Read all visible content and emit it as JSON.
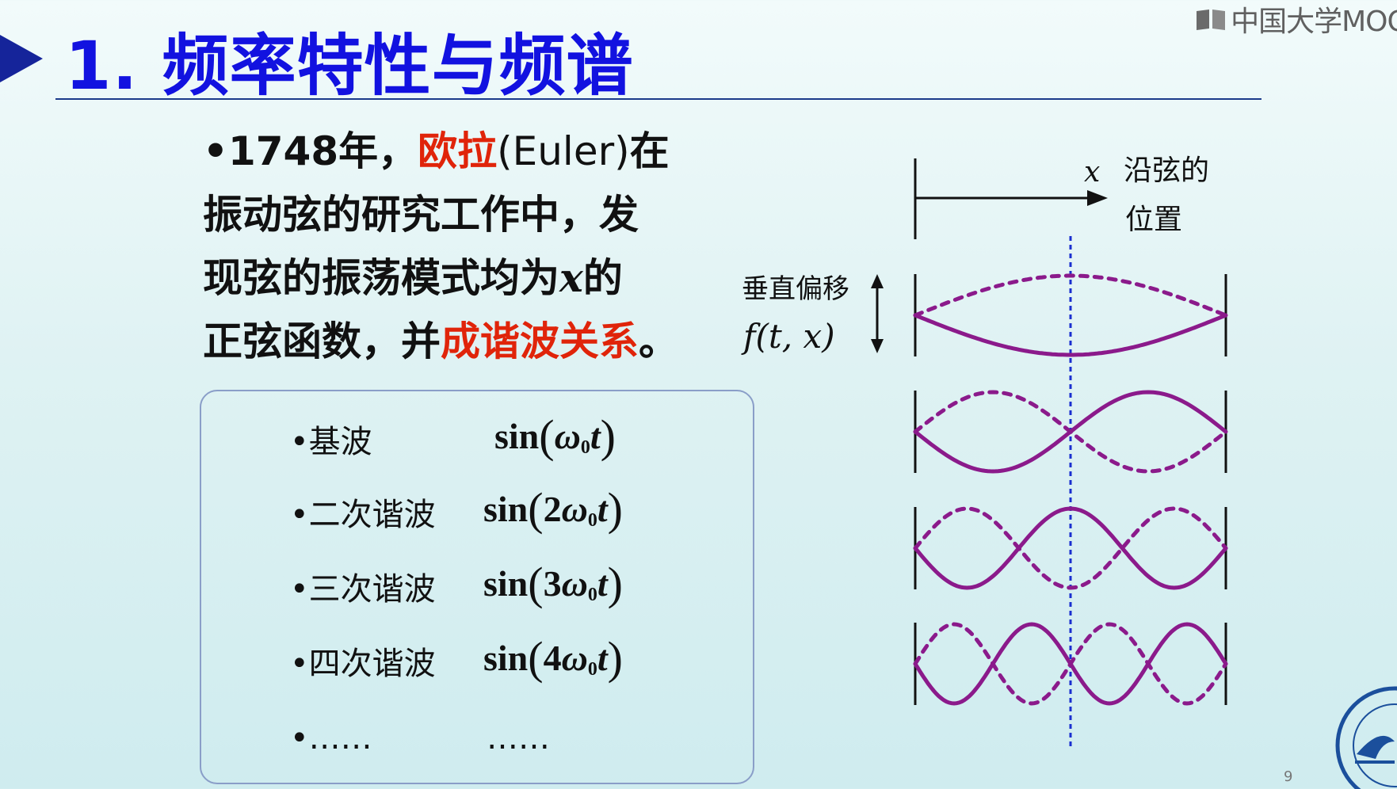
{
  "header": {
    "number": "1.",
    "title": "频率特性与频谱",
    "watermark": "中国大学MOOC"
  },
  "intro": {
    "bullet": "•",
    "year": "1748年，",
    "name": "欧拉",
    "name_en": "(Euler)",
    "line1_end": "在",
    "line2": "振动弦的研究工作中，发",
    "line3_pre": "现弦的振荡模式均为",
    "line3_var": "x",
    "line3_post": "的",
    "line4_pre": "正弦函数，并",
    "line4_em": "成谐波关系",
    "line4_end": "。"
  },
  "harmonics": [
    {
      "label": "•基波",
      "fn": "sin",
      "coef": "",
      "omega": "ω",
      "sub": "0",
      "var": "t"
    },
    {
      "label": "•二次谐波",
      "fn": "sin",
      "coef": "2",
      "omega": "ω",
      "sub": "0",
      "var": "t"
    },
    {
      "label": "•三次谐波",
      "fn": "sin",
      "coef": "3",
      "omega": "ω",
      "sub": "0",
      "var": "t"
    },
    {
      "label": "•四次谐波",
      "fn": "sin",
      "coef": "4",
      "omega": "ω",
      "sub": "0",
      "var": "t"
    }
  ],
  "harmonics_more": {
    "label": "•……",
    "formula": "……"
  },
  "diagram": {
    "x_axis_symbol": "x",
    "position_label_1": "沿弦的",
    "position_label_2": "位置",
    "vertical_label": "垂直偏移",
    "function_label": "f(t, x)",
    "modes": [
      1,
      2,
      3,
      4
    ],
    "wave_color": "#8b1a8b",
    "center_line_color": "#1a2fd0"
  },
  "page_number": "9"
}
